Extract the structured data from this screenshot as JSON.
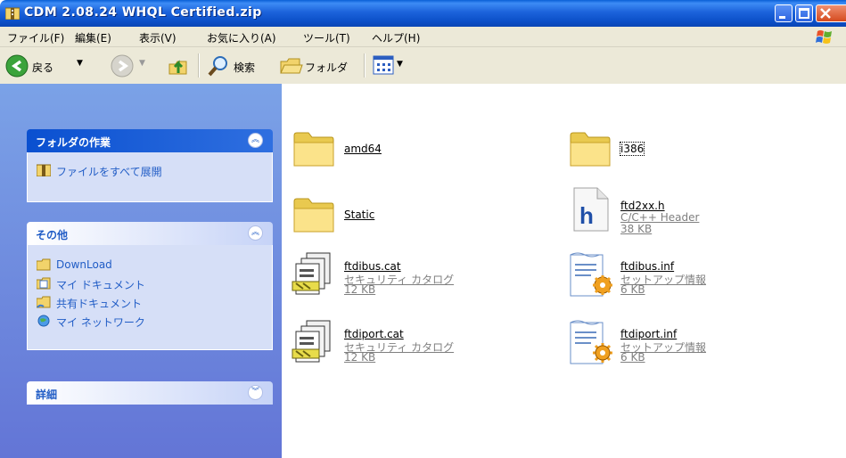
{
  "window": {
    "title": "CDM 2.08.24 WHQL Certified.zip",
    "title_icon": "zip-folder-icon"
  },
  "menu": [
    "ファイル(F)",
    "編集(E)",
    "表示(V)",
    "お気に入り(A)",
    "ツール(T)",
    "ヘルプ(H)"
  ],
  "toolbar": {
    "back_label": "戻る",
    "search_label": "検索",
    "folders_label": "フォルダ"
  },
  "tasks": {
    "title": "フォルダの作業",
    "items": [
      {
        "label": "ファイルをすべて展開",
        "icon": "extract-icon"
      }
    ]
  },
  "other": {
    "title": "その他",
    "items": [
      {
        "label": "DownLoad",
        "icon": "folder-icon"
      },
      {
        "label": "マイ ドキュメント",
        "icon": "my-documents-icon"
      },
      {
        "label": "共有ドキュメント",
        "icon": "shared-folder-icon"
      },
      {
        "label": "マイ ネットワーク",
        "icon": "network-icon"
      }
    ]
  },
  "details": {
    "title": "詳細"
  },
  "files": [
    {
      "name": "amd64",
      "type": "",
      "size": "",
      "icon": "folder-icon"
    },
    {
      "name": "i386",
      "type": "",
      "size": "",
      "icon": "folder-icon"
    },
    {
      "name": "Static",
      "type": "",
      "size": "",
      "icon": "folder-icon"
    },
    {
      "name": "ftd2xx.h",
      "type": "C/C++ Header",
      "size": "38 KB",
      "icon": "header-file-icon"
    },
    {
      "name": "ftdibus.cat",
      "type": "セキュリティ カタログ",
      "size": "12 KB",
      "icon": "security-catalog-icon"
    },
    {
      "name": "ftdibus.inf",
      "type": "セットアップ情報",
      "size": "6 KB",
      "icon": "setup-info-icon"
    },
    {
      "name": "ftdiport.cat",
      "type": "セキュリティ カタログ",
      "size": "12 KB",
      "icon": "security-catalog-icon"
    },
    {
      "name": "ftdiport.inf",
      "type": "セットアップ情報",
      "size": "6 KB",
      "icon": "setup-info-icon"
    }
  ],
  "colors": {
    "titlebar": "#0b4fc8",
    "taskpane": "#6f8ce0",
    "link": "#215dc6"
  }
}
